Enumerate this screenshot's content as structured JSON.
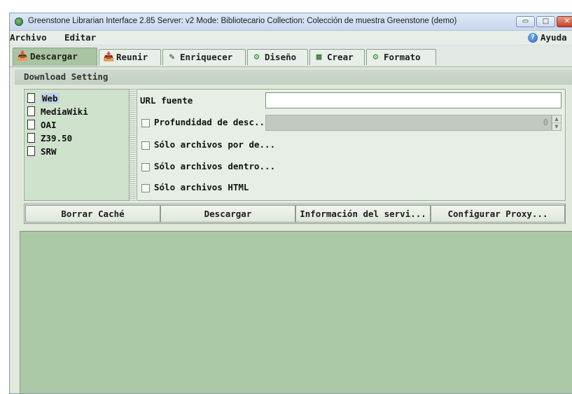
{
  "window": {
    "title": "Greenstone Librarian Interface 2.85  Server: v2  Mode: Bibliotecario  Collection: Colección de muestra Greenstone (demo)",
    "controls": {
      "minimize": "▭",
      "maximize": "□",
      "close": "✕"
    }
  },
  "menu": {
    "items": [
      "Archivo",
      "Editar"
    ],
    "help_label": "Ayuda",
    "help_icon": "help-icon"
  },
  "tabs": [
    {
      "label": "Descargar",
      "icon": "download-icon",
      "active": true
    },
    {
      "label": "Reunir",
      "icon": "gather-icon",
      "active": false
    },
    {
      "label": "Enriquecer",
      "icon": "enrich-icon",
      "active": false
    },
    {
      "label": "Diseño",
      "icon": "gear-icon",
      "active": false
    },
    {
      "label": "Crear",
      "icon": "build-icon",
      "active": false
    },
    {
      "label": "Formato",
      "icon": "gear-icon",
      "active": false
    }
  ],
  "download": {
    "section_title": "Download Setting",
    "protocols": [
      {
        "label": "Web",
        "selected": true
      },
      {
        "label": "MediaWiki",
        "selected": false
      },
      {
        "label": "OAI",
        "selected": false
      },
      {
        "label": "Z39.50",
        "selected": false
      },
      {
        "label": "SRW",
        "selected": false
      }
    ],
    "url_label": "URL fuente",
    "url_value": "",
    "depth_label": "Profundidad de desc...",
    "depth_value": "0",
    "options": [
      {
        "label": "Sólo archivos por de...",
        "checked": false
      },
      {
        "label": "Sólo archivos dentro...",
        "checked": false
      },
      {
        "label": "Sólo archivos HTML",
        "checked": false
      }
    ],
    "buttons": {
      "clear_cache": "Borrar Caché",
      "download": "Descargar",
      "server_info": "Información del servi...",
      "proxy": "Configurar Proxy..."
    }
  },
  "colors": {
    "active_tab": "#a9c4a0",
    "list_background": "#cfe2cc",
    "log_background": "#abc9a5"
  }
}
